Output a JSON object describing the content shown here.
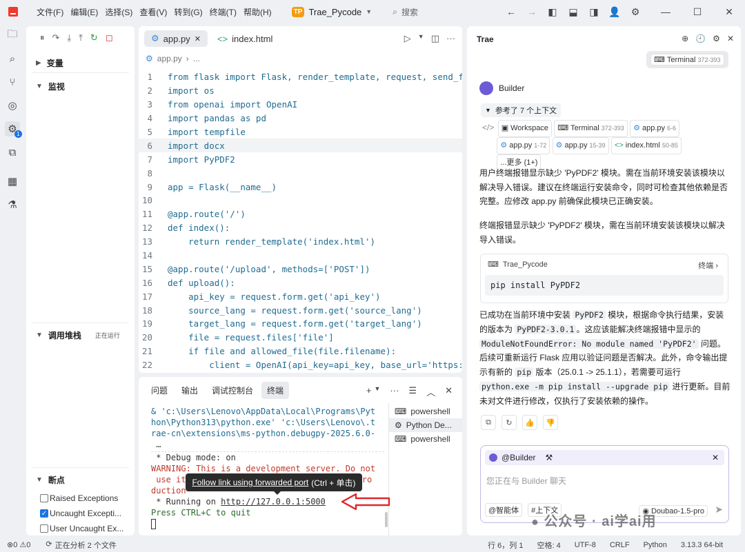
{
  "titlebar": {
    "menu": [
      "文件(F)",
      "编辑(E)",
      "选择(S)",
      "查看(V)",
      "转到(G)",
      "终端(T)",
      "帮助(H)"
    ],
    "project_badge": "TP",
    "project_name": "Trae_Pycode",
    "search_label": "搜索"
  },
  "sidebar": {
    "variables": "变量",
    "watch": "监视",
    "callstack": "调用堆栈",
    "callstack_status": "正在运行",
    "breakpoints": "断点",
    "bp_items": [
      {
        "label": "Raised Exceptions",
        "checked": false
      },
      {
        "label": "Uncaught Excepti...",
        "checked": true
      },
      {
        "label": "User Uncaught Ex...",
        "checked": false
      }
    ]
  },
  "editor": {
    "tabs": [
      {
        "label": "app.py"
      },
      {
        "label": "index.html"
      }
    ],
    "breadcrumb": [
      "app.py",
      "..."
    ],
    "lines": [
      {
        "n": "1",
        "t": "from flask import Flask, render_template, request, send_fi"
      },
      {
        "n": "2",
        "t": "import os"
      },
      {
        "n": "3",
        "t": "from openai import OpenAI"
      },
      {
        "n": "4",
        "t": "import pandas as pd"
      },
      {
        "n": "5",
        "t": "import tempfile"
      },
      {
        "n": "6",
        "t": "import docx"
      },
      {
        "n": "7",
        "t": "import PyPDF2"
      },
      {
        "n": "8",
        "t": ""
      },
      {
        "n": "9",
        "t": "app = Flask(__name__)"
      },
      {
        "n": "10",
        "t": ""
      },
      {
        "n": "11",
        "t": "@app.route('/')"
      },
      {
        "n": "12",
        "t": "def index():"
      },
      {
        "n": "13",
        "t": "    return render_template('index.html')"
      },
      {
        "n": "14",
        "t": ""
      },
      {
        "n": "15",
        "t": "@app.route('/upload', methods=['POST'])"
      },
      {
        "n": "16",
        "t": "def upload():"
      },
      {
        "n": "17",
        "t": "    api_key = request.form.get('api_key')"
      },
      {
        "n": "18",
        "t": "    source_lang = request.form.get('source_lang')"
      },
      {
        "n": "19",
        "t": "    target_lang = request.form.get('target_lang')"
      },
      {
        "n": "20",
        "t": "    file = request.files['file']"
      },
      {
        "n": "21",
        "t": "    if file and allowed_file(file.filename):"
      },
      {
        "n": "22",
        "t": "        client = OpenAI(api_key=api_key, base_url='https:/"
      }
    ]
  },
  "panel": {
    "tabs": [
      "问题",
      "输出",
      "调试控制台",
      "终端"
    ],
    "terminal": {
      "l1": "& 'c:\\Users\\Lenovo\\AppData\\Local\\Programs\\Pyt",
      "l2": "hon\\Python313\\python.exe' 'c:\\Users\\Lenovo\\.t",
      "l3": "rae-cn\\extensions\\ms-python.debugpy-2025.6.0-",
      "l4": " …",
      "l5": " * Debug mode: on",
      "l6": "WARNING: This is a development server. Do not",
      "l7a": " use it",
      "l7b": "pro",
      "l8": "duction",
      "l9a": " * Running on ",
      "l9b": "http://127.0.0.1:5000",
      "l10": "Press CTRL+C to quit"
    },
    "terminal_list": [
      "powershell",
      "Python De...",
      "powershell"
    ],
    "tooltip_link": "Follow link using forwarded port",
    "tooltip_hint": "(Ctrl + 单击)"
  },
  "chat": {
    "header": "Trae",
    "top_chip_label": "Terminal",
    "top_chip_range": "372-393",
    "builder_name": "Builder",
    "context_toggle": "参考了 7 个上下文",
    "context_chips": [
      {
        "label": "Workspace",
        "range": ""
      },
      {
        "label": "Terminal",
        "range": "372-393"
      },
      {
        "label": "app.py",
        "range": "6-6"
      },
      {
        "label": "app.py",
        "range": "1-72"
      },
      {
        "label": "app.py",
        "range": "15-39"
      },
      {
        "label": "index.html",
        "range": "50-85"
      },
      {
        "label": "...更多 (1+)",
        "range": ""
      }
    ],
    "para1": "用户终端报错显示缺少 'PyPDF2' 模块。需在当前环境安装该模块以解决导入错误。建议在终端运行安装命令，同时可检查其他依赖是否完整。应修改 app.py 前确保此模块已正确安装。",
    "para2": "终端报错显示缺少 'PyPDF2' 模块，需在当前环境安装该模块以解决导入错误。",
    "cmd_project": "Trae_Pycode",
    "cmd_terminal": "终端",
    "cmd_text": "pip install PyPDF2",
    "p3": {
      "a": "已成功在当前环境中安装 ",
      "b": "PyPDF2",
      "c": " 模块，根据命令执行结果，安装的版本为 ",
      "d": "PyPDF2-3.0.1",
      "e": "。这应该能解决终端报错中显示的 ",
      "f": "ModuleNotFoundError: No module named 'PyPDF2'",
      "g": " 问题。后续可重新运行 Flask 应用以验证问题是否解决。此外，命令输出提示有新的 ",
      "h": "pip",
      "i": " 版本（25.0.1 -> 25.1.1），若需要可运行 ",
      "j": "python.exe -m pip install --upgrade pip",
      "k": " 进行更新。目前未对文件进行修改，仅执行了安装依赖的操作。"
    },
    "input_mention": "@Builder",
    "input_placeholder": "您正在与 Builder 聊天",
    "btn_agent": "@智能体",
    "btn_context": "#上下文",
    "model": "Doubao-1.5-pro"
  },
  "status": {
    "counts": "⊗0 ⚠0",
    "analyzing": "正在分析 2 个文件",
    "position": "行 6，列 1",
    "spaces": "空格: 4",
    "encoding": "UTF-8",
    "eol": "CRLF",
    "language": "Python",
    "interpreter": "3.13.3 64-bit"
  },
  "watermark": "公众号 · ai学ai用",
  "colors": {
    "accent": "#1a73e8",
    "arrow": "#e0262b",
    "builder": "#6b5bd6"
  }
}
